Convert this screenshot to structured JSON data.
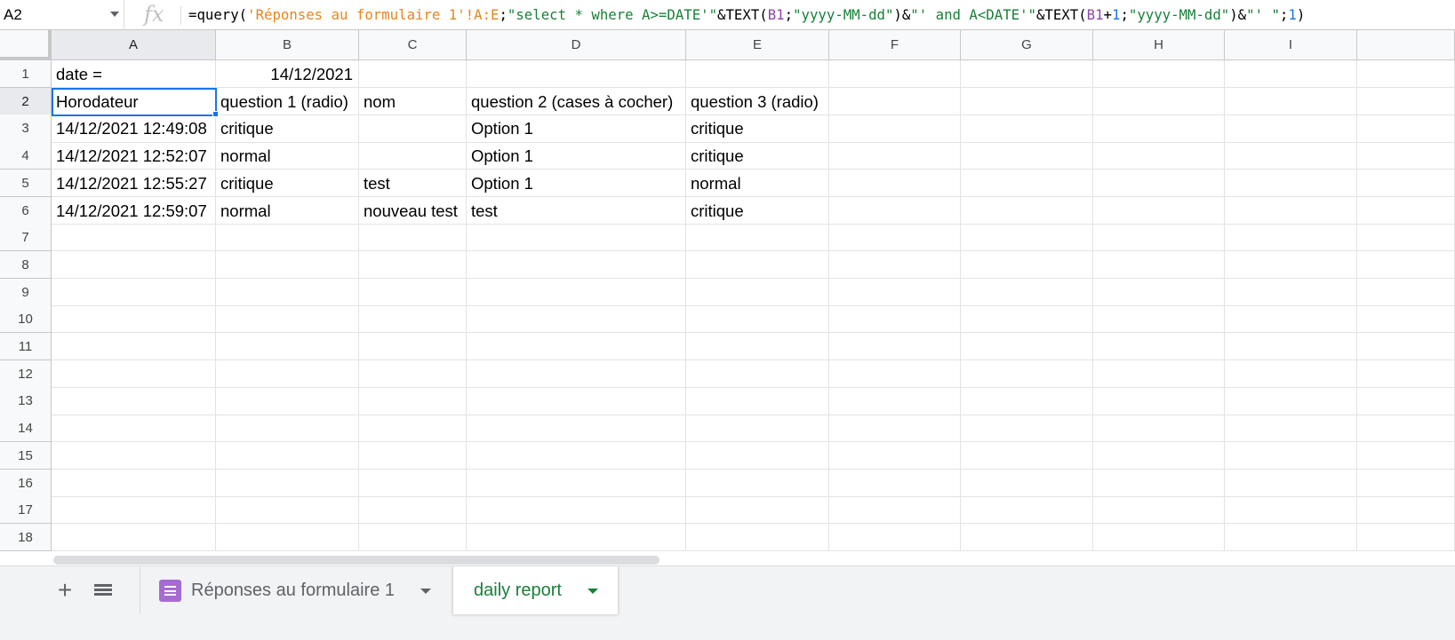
{
  "name_box": {
    "value": "A2"
  },
  "formula_bar": {
    "fx": "fx",
    "segments": [
      {
        "text": "=query(",
        "color": "#000000"
      },
      {
        "text": "'Réponses au formulaire 1'!A:E",
        "color": "#e8851a"
      },
      {
        "text": ";",
        "color": "#000000"
      },
      {
        "text": "\"select * where A>=DATE'\"",
        "color": "#188038"
      },
      {
        "text": "&TEXT(",
        "color": "#000000"
      },
      {
        "text": "B1",
        "color": "#8e44ad"
      },
      {
        "text": ";",
        "color": "#000000"
      },
      {
        "text": "\"yyyy-MM-dd\"",
        "color": "#188038"
      },
      {
        "text": ")&",
        "color": "#000000"
      },
      {
        "text": "\"' and A<DATE'\"",
        "color": "#188038"
      },
      {
        "text": "&TEXT(",
        "color": "#000000"
      },
      {
        "text": "B1",
        "color": "#8e44ad"
      },
      {
        "text": "+",
        "color": "#000000"
      },
      {
        "text": "1",
        "color": "#1a73e8"
      },
      {
        "text": ";",
        "color": "#000000"
      },
      {
        "text": "\"yyyy-MM-dd\"",
        "color": "#188038"
      },
      {
        "text": ")&",
        "color": "#000000"
      },
      {
        "text": "\"' \"",
        "color": "#188038"
      },
      {
        "text": ";",
        "color": "#000000"
      },
      {
        "text": "1",
        "color": "#1a73e8"
      },
      {
        "text": ")",
        "color": "#000000"
      }
    ]
  },
  "columns": [
    "A",
    "B",
    "C",
    "D",
    "E",
    "F",
    "G",
    "H",
    "I"
  ],
  "rows": [
    "1",
    "2",
    "3",
    "4",
    "5",
    "6",
    "7",
    "8",
    "9",
    "10",
    "11",
    "12",
    "13",
    "14",
    "15",
    "16",
    "17",
    "18"
  ],
  "selected": {
    "column": "A",
    "row": "2"
  },
  "cells": {
    "r1": {
      "a": "date =",
      "b": "14/12/2021"
    },
    "r2": {
      "a": "Horodateur",
      "b": "question 1 (radio)",
      "c": "nom",
      "d": "question 2 (cases à cocher)",
      "e": "question 3 (radio)"
    },
    "r3": {
      "a": "14/12/2021 12:49:08",
      "b": "critique",
      "c": "",
      "d": "Option 1",
      "e": "critique"
    },
    "r4": {
      "a": "14/12/2021 12:52:07",
      "b": "normal",
      "c": "",
      "d": "Option 1",
      "e": "critique"
    },
    "r5": {
      "a": "14/12/2021 12:55:27",
      "b": "critique",
      "c": "test",
      "d": "Option 1",
      "e": "normal"
    },
    "r6": {
      "a": "14/12/2021 12:59:07",
      "b": "normal",
      "c": "nouveau test",
      "d": "test",
      "e": "critique"
    }
  },
  "sheet_tabs": [
    {
      "label": "Réponses au formulaire 1",
      "icon": "forms-icon",
      "active": false
    },
    {
      "label": "daily report",
      "active": true
    }
  ],
  "colors": {
    "accent": "#1a73e8",
    "active_tab": "#188038",
    "forms_icon": "#a66bd3"
  }
}
